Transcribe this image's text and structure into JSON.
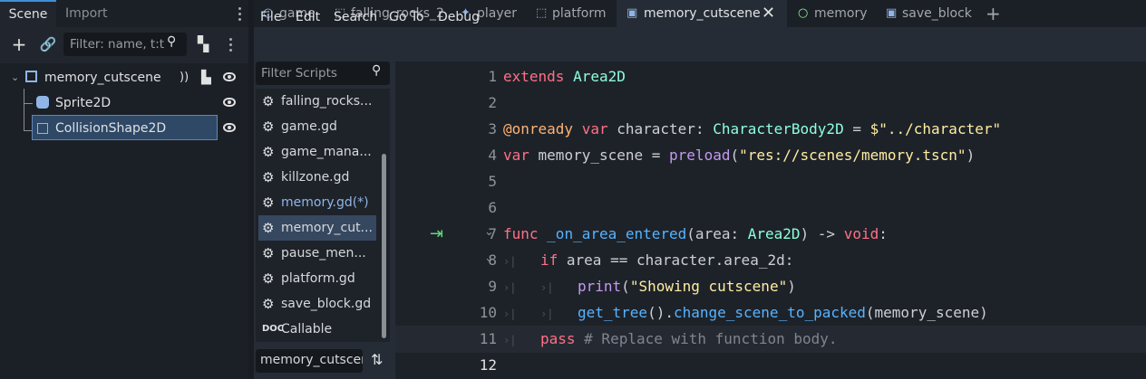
{
  "left_dock": {
    "tabs": [
      "Scene",
      "Import"
    ],
    "filter_placeholder": "Filter: name, t:t",
    "tree": [
      {
        "label": "memory_cutscene"
      },
      {
        "label": "Sprite2D"
      },
      {
        "label": "CollisionShape2D"
      }
    ]
  },
  "editor_tabs": [
    {
      "label": "game",
      "icon": "circle-icon"
    },
    {
      "label": "falling_rocks_2",
      "icon": "scene-icon"
    },
    {
      "label": "player",
      "icon": "player-icon"
    },
    {
      "label": "platform",
      "icon": "scene-icon"
    },
    {
      "label": "memory_cutscene",
      "icon": "area-icon"
    },
    {
      "label": "memory",
      "icon": "circle-icon"
    },
    {
      "label": "save_block",
      "icon": "area-icon"
    }
  ],
  "menu": [
    "File",
    "Edit",
    "Search",
    "Go To",
    "Debug"
  ],
  "scripts": {
    "filter_placeholder": "Filter Scripts",
    "items": [
      "falling_rocks...",
      "game.gd",
      "game_mana...",
      "killzone.gd",
      "memory.gd(*)",
      "memory_cut...",
      "pause_men...",
      "platform.gd",
      "save_block.gd",
      "Callable"
    ],
    "method_filter": "memory_cutscen"
  },
  "code": {
    "line_numbers": [
      "1",
      "2",
      "3",
      "4",
      "5",
      "6",
      "7",
      "8",
      "9",
      "10",
      "11",
      "12"
    ],
    "l1": [
      "extends",
      " ",
      "Area2D"
    ],
    "l3": [
      "@onready",
      " ",
      "var",
      " character: ",
      "CharacterBody2D",
      " = ",
      "$\"../character\""
    ],
    "l4": [
      "var",
      " memory_scene = ",
      "preload",
      "(",
      "\"res://scenes/memory.tscn\"",
      ")"
    ],
    "l7": [
      "func",
      " ",
      "_on_area_entered",
      "(area: ",
      "Area2D",
      ") -> ",
      "void",
      ":"
    ],
    "l8": [
      "if",
      " area == character.area_2d:"
    ],
    "l9": [
      "print",
      "(",
      "\"Showing cutscene\"",
      ")"
    ],
    "l10": [
      "get_tree",
      "().",
      "change_scene_to_packed",
      "(memory_scene)"
    ],
    "l11": [
      "pass",
      " # Replace with function body."
    ]
  }
}
